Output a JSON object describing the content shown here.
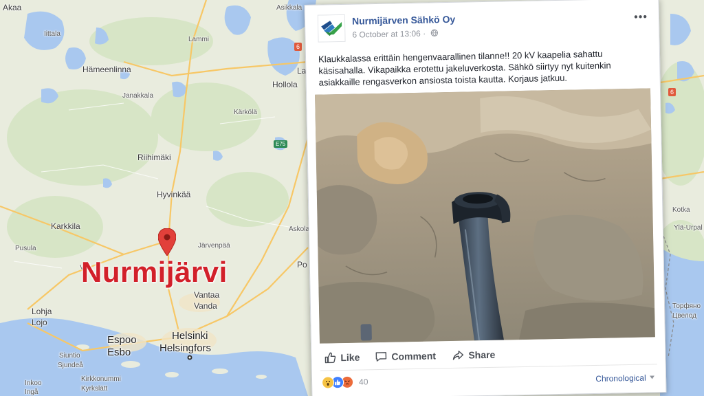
{
  "map": {
    "highlight_place": "Nurmijärvi",
    "places": [
      {
        "name": "Akaa",
        "size": "mid"
      },
      {
        "name": "Asikkala",
        "size": "small"
      },
      {
        "name": "Iittala",
        "size": "small"
      },
      {
        "name": "Lammi",
        "size": "small"
      },
      {
        "name": "Hämeenlinna",
        "size": "mid"
      },
      {
        "name": "Janakkala",
        "size": "small"
      },
      {
        "name": "Hollola",
        "size": "mid"
      },
      {
        "name": "Kärkölä",
        "size": "small"
      },
      {
        "name": "Riihimäki",
        "size": "mid"
      },
      {
        "name": "Hyvinkää",
        "size": "mid"
      },
      {
        "name": "Karkkila",
        "size": "mid"
      },
      {
        "name": "Järvenpää",
        "size": "small"
      },
      {
        "name": "Askola",
        "size": "small"
      },
      {
        "name": "Pusula",
        "size": "small"
      },
      {
        "name": "Vantaa",
        "size": "mid"
      },
      {
        "name": "Vanda",
        "size": "mid"
      },
      {
        "name": "Lohja",
        "size": "mid"
      },
      {
        "name": "Lojo",
        "size": "mid"
      },
      {
        "name": "Espoo",
        "size": "big"
      },
      {
        "name": "Esbo",
        "size": "big"
      },
      {
        "name": "Helsinki",
        "size": "big"
      },
      {
        "name": "Helsingfors",
        "size": "big"
      },
      {
        "name": "Siuntio",
        "size": "small"
      },
      {
        "name": "Sjundeå",
        "size": "small"
      },
      {
        "name": "Inkoo",
        "size": "small"
      },
      {
        "name": "Ingå",
        "size": "small"
      },
      {
        "name": "Kirkkonummi",
        "size": "small"
      },
      {
        "name": "Kyrkslätt",
        "size": "small"
      },
      {
        "name": "Kotka",
        "size": "small"
      },
      {
        "name": "Ylä-Urpal",
        "size": "small"
      },
      {
        "name": "Торфяно",
        "size": "small"
      },
      {
        "name": "Цвелод",
        "size": "small"
      },
      {
        "name": "Lah",
        "size": "mid"
      },
      {
        "name": "Po",
        "size": "mid"
      },
      {
        "name": "Vi",
        "size": "small"
      }
    ],
    "road_labels": [
      "E75",
      "6",
      "6"
    ]
  },
  "post": {
    "page_name": "Nurmijärven Sähkö Oy",
    "timestamp": "6 October at 13:06",
    "separator": "·",
    "more_menu": "•••",
    "text": "Klaukkalassa erittäin hengenvaarallinen tilanne!! 20 kV kaapelia sahattu käsisahalla. Vikapaikka erotettu jakeluverkosta. Sähkö siirtyy nyt kuitenkin asiakkaille rengasverkon ansiosta toista kautta. Korjaus jatkuu.",
    "actions": {
      "like": "Like",
      "comment": "Comment",
      "share": "Share"
    },
    "reactions": {
      "icons": [
        "wow-reaction-icon",
        "like-reaction-icon",
        "angry-reaction-icon"
      ],
      "count": "40"
    },
    "sort_label": "Chronological",
    "colors": {
      "page_name": "#365899",
      "meta": "#90949c",
      "highlight": "#d2202a"
    }
  }
}
